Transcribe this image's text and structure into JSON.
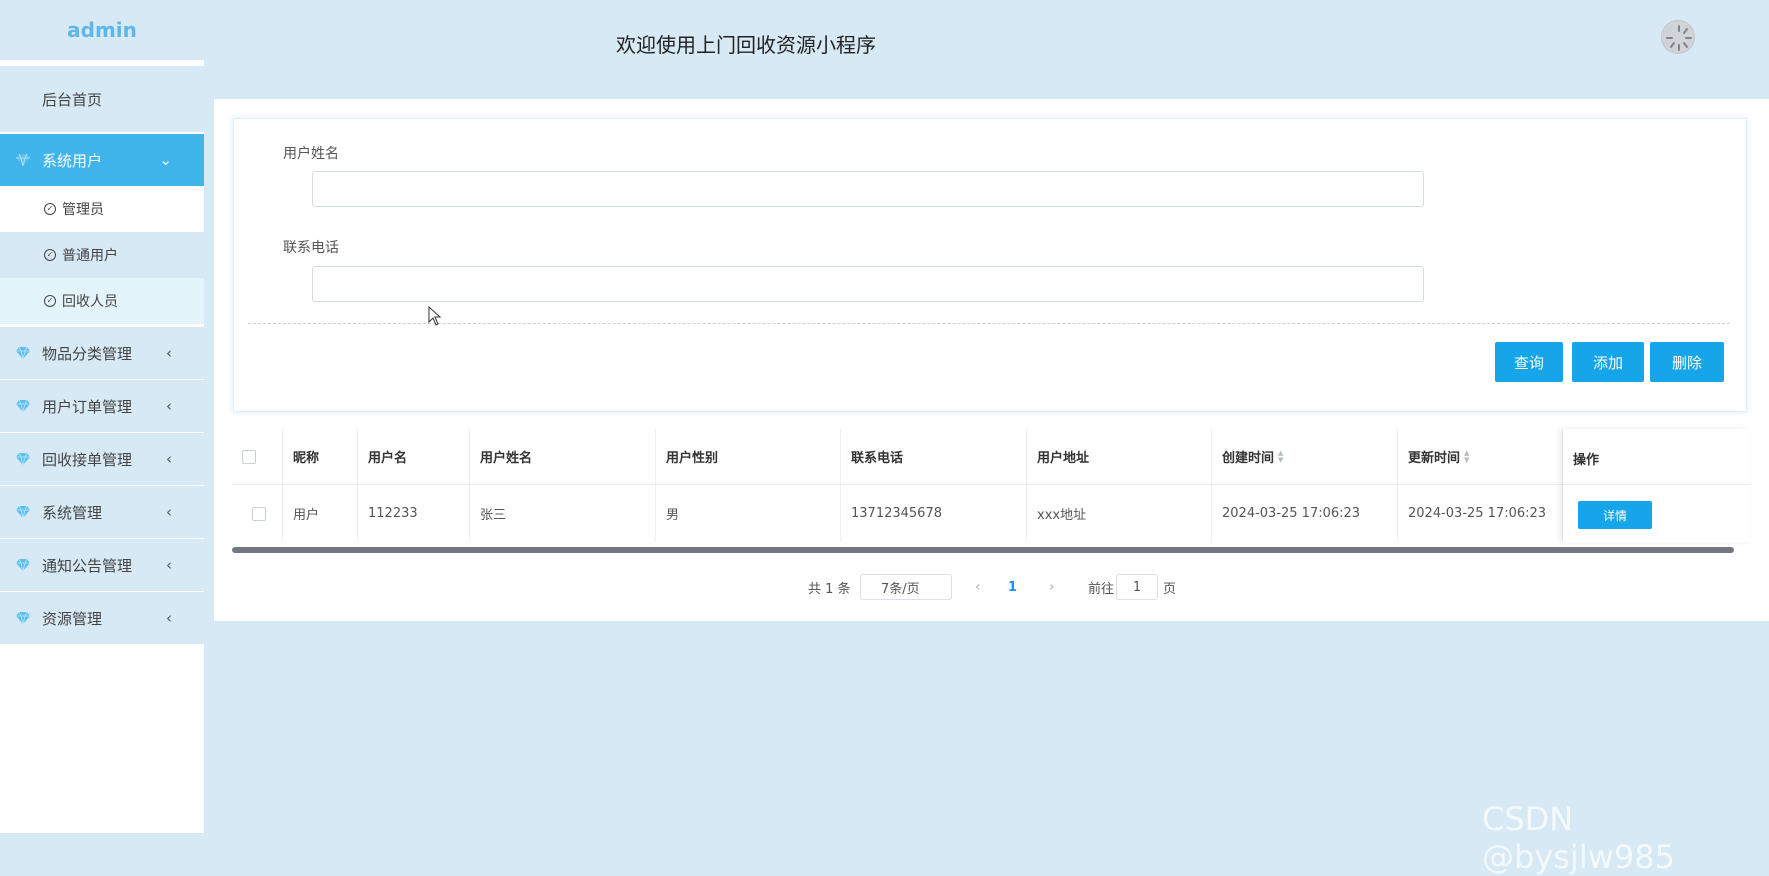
{
  "app": {
    "brand": "admin",
    "title": "欢迎使用上门回收资源小程序"
  },
  "sidebar": {
    "home": "后台首页",
    "active_group": {
      "label": "系统用户",
      "icon": "gem-icon"
    },
    "sub_items": [
      {
        "label": "管理员",
        "icon": "check-circle-icon"
      },
      {
        "label": "普通用户",
        "icon": "check-circle-icon"
      },
      {
        "label": "回收人员",
        "icon": "check-circle-icon"
      }
    ],
    "groups": [
      {
        "label": "物品分类管理",
        "icon": "gem-icon"
      },
      {
        "label": "用户订单管理",
        "icon": "gem-icon"
      },
      {
        "label": "回收接单管理",
        "icon": "gem-icon"
      },
      {
        "label": "系统管理",
        "icon": "gem-icon"
      },
      {
        "label": "通知公告管理",
        "icon": "gem-icon"
      },
      {
        "label": "资源管理",
        "icon": "gem-icon"
      }
    ]
  },
  "search": {
    "name_label": "用户姓名",
    "name_value": "",
    "phone_label": "联系电话",
    "phone_value": "",
    "query_button": "查询",
    "add_button": "添加",
    "delete_button": "删除"
  },
  "table": {
    "columns": [
      "昵称",
      "用户名",
      "用户姓名",
      "用户性别",
      "联系电话",
      "用户地址",
      "创建时间",
      "更新时间",
      "操作"
    ],
    "rows": [
      {
        "nickname": "用户",
        "username": "112233",
        "name": "张三",
        "gender": "男",
        "phone": "13712345678",
        "address": "xxx地址",
        "created": "2024-03-25 17:06:23",
        "updated": "2024-03-25 17:06:23",
        "action": "详情"
      }
    ]
  },
  "pagination": {
    "total": "共 1 条",
    "page_size": "7条/页",
    "current_page": "1",
    "goto_prefix": "前往",
    "goto_value": "1",
    "goto_suffix": "页"
  },
  "watermark": "CSDN @bysjlw985",
  "colors": {
    "accent": "#15a5e8",
    "sidebar_active": "#3fb5ec",
    "background": "#d6e9f5"
  }
}
